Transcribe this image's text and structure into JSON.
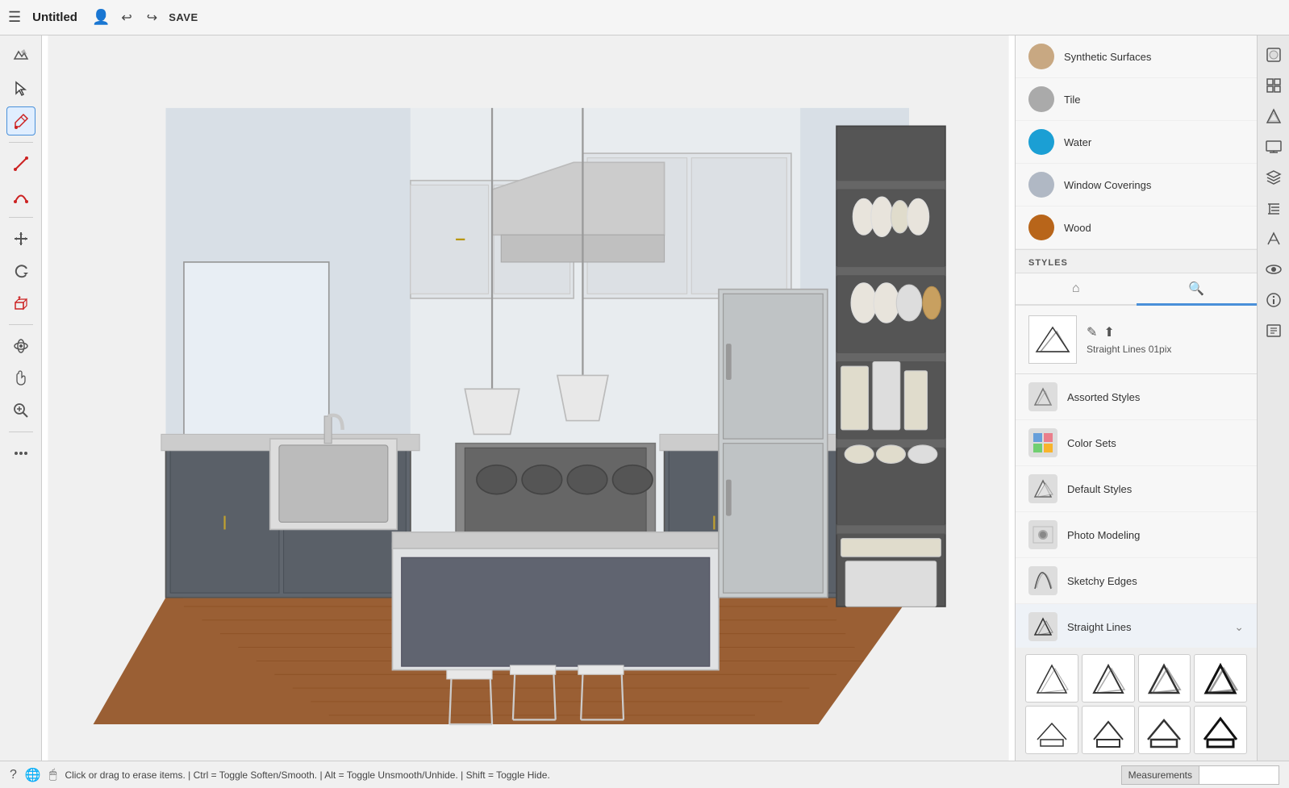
{
  "topbar": {
    "hamburger_icon": "☰",
    "title": "Untitled",
    "user_icon": "👤",
    "undo_icon": "↩",
    "redo_icon": "↪",
    "save_label": "SAVE"
  },
  "left_toolbar": {
    "tools": [
      {
        "name": "plane-tool",
        "icon": "✈",
        "active": false
      },
      {
        "name": "select-tool",
        "icon": "↖",
        "active": false
      },
      {
        "name": "paint-tool",
        "icon": "✏",
        "active": true,
        "red": true
      },
      {
        "name": "line-tool",
        "icon": "╱",
        "active": false,
        "red": true
      },
      {
        "name": "arc-tool",
        "icon": "⌒",
        "active": false,
        "red": true
      },
      {
        "name": "move-tool",
        "icon": "✛",
        "active": false
      },
      {
        "name": "rotate-tool",
        "icon": "↺",
        "active": false
      },
      {
        "name": "push-pull-tool",
        "icon": "⊡",
        "active": false,
        "red": true
      },
      {
        "name": "orbit-tool",
        "icon": "⊕",
        "active": false
      },
      {
        "name": "pan-tool",
        "icon": "✋",
        "active": false
      },
      {
        "name": "zoom-tool",
        "icon": "⊙",
        "active": false
      },
      {
        "name": "more-tool",
        "icon": "⋯",
        "active": false
      }
    ]
  },
  "right_panel": {
    "materials": [
      {
        "name": "Synthetic Surfaces",
        "color": "#c8a882",
        "type": "round"
      },
      {
        "name": "Tile",
        "color": "#aaaaaa",
        "type": "round"
      },
      {
        "name": "Water",
        "color": "#1b9fd4",
        "type": "round"
      },
      {
        "name": "Window Coverings",
        "color": "#b0b8c4",
        "type": "round"
      },
      {
        "name": "Wood",
        "color": "#b8651a",
        "type": "round"
      }
    ],
    "styles_header": "STYLES",
    "styles_tabs": [
      {
        "name": "home-tab",
        "icon": "⌂",
        "active": false
      },
      {
        "name": "search-tab",
        "icon": "🔍",
        "active": true
      }
    ],
    "current_style": {
      "label": "Straight Lines 01pix",
      "edit_icon": "✏",
      "upload_icon": "⬆"
    },
    "style_items": [
      {
        "name": "Assorted Styles",
        "expanded": false
      },
      {
        "name": "Color Sets",
        "expanded": false
      },
      {
        "name": "Default Styles",
        "expanded": false
      },
      {
        "name": "Photo Modeling",
        "expanded": false
      },
      {
        "name": "Sketchy Edges",
        "expanded": false
      },
      {
        "name": "Straight Lines",
        "expanded": true
      }
    ],
    "style_grid": [
      {
        "label": "sl1"
      },
      {
        "label": "sl2"
      },
      {
        "label": "sl3"
      },
      {
        "label": "sl4"
      },
      {
        "label": "sl5"
      },
      {
        "label": "sl6"
      },
      {
        "label": "sl7"
      },
      {
        "label": "sl8"
      }
    ]
  },
  "far_right": {
    "icons": [
      {
        "name": "materials-icon",
        "icon": "◻"
      },
      {
        "name": "components-icon",
        "icon": "⊞"
      },
      {
        "name": "styles-icon",
        "icon": "◈"
      },
      {
        "name": "scenes-icon",
        "icon": "⊕"
      },
      {
        "name": "layers-icon",
        "icon": "≡"
      },
      {
        "name": "outliner-icon",
        "icon": "📋"
      },
      {
        "name": "edit-icon",
        "icon": "✎"
      },
      {
        "name": "view-icon",
        "icon": "👁"
      },
      {
        "name": "info-icon",
        "icon": "ⓘ"
      },
      {
        "name": "instructor-icon",
        "icon": "📚"
      }
    ]
  },
  "bottom_bar": {
    "help_icon": "?",
    "globe_icon": "🌐",
    "cursor_icon": "🖱",
    "status_text": "Click or drag to erase items.  |  Ctrl = Toggle Soften/Smooth.  |  Alt = Toggle Unsmooth/Unhide.  |  Shift = Toggle Hide.",
    "measurements_label": "Measurements",
    "measurements_value": ""
  }
}
